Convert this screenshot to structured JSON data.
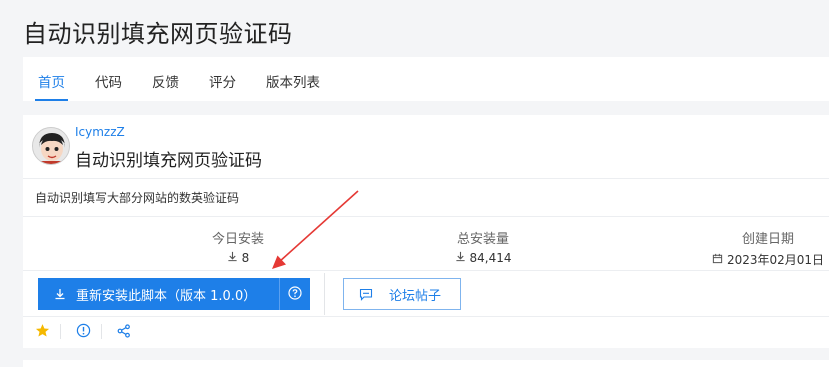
{
  "page": {
    "title": "自动识别填充网页验证码"
  },
  "tabs": [
    {
      "label": "首页",
      "active": true
    },
    {
      "label": "代码"
    },
    {
      "label": "反馈"
    },
    {
      "label": "评分"
    },
    {
      "label": "版本列表"
    }
  ],
  "script": {
    "author": "IcymzzZ",
    "title": "自动识别填充网页验证码",
    "description": "自动识别填写大部分网站的数英验证码"
  },
  "stats": {
    "today": {
      "label": "今日安装",
      "value": "8"
    },
    "total": {
      "label": "总安装量",
      "value": "84,414"
    },
    "created": {
      "label": "创建日期",
      "value": "2023年02月01日"
    }
  },
  "actions": {
    "install_label": "重新安装此脚本（版本 1.0.0）",
    "forum_label": "论坛帖子"
  },
  "icons": {
    "download": "download-icon",
    "calendar": "calendar-icon",
    "help": "help-circle-icon",
    "comment": "comment-icon",
    "star": "star-icon",
    "info": "info-icon",
    "share": "share-icon"
  },
  "colors": {
    "accent": "#1e7fe8",
    "star": "#f5b800",
    "annotation": "#e53935"
  }
}
